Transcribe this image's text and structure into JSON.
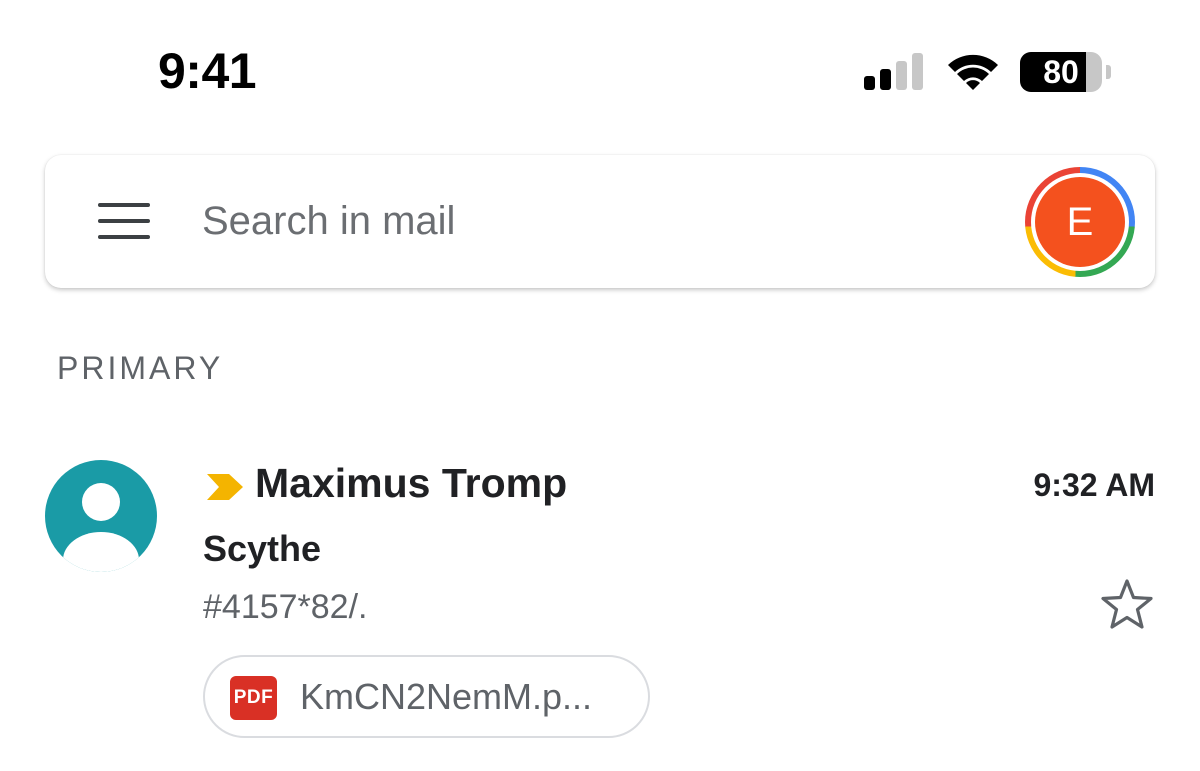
{
  "status_bar": {
    "time": "9:41",
    "battery_level": "80",
    "signal_bars_active": 2,
    "signal_bars_total": 4
  },
  "search": {
    "placeholder": "Search in mail",
    "account_initial": "E",
    "account_avatar_color": "#f4511e"
  },
  "section": {
    "label": "PRIMARY"
  },
  "emails": [
    {
      "sender": "Maximus Tromp",
      "time": "9:32 AM",
      "subject": "Scythe",
      "snippet": "#4157*82/.",
      "important": true,
      "starred": false,
      "avatar_color": "#1a9ba6",
      "attachment": {
        "type_label": "PDF",
        "name": "KmCN2NemM.p..."
      }
    }
  ],
  "colors": {
    "importance_marker": "#f4b400",
    "pdf_badge": "#d93025",
    "secondary_text": "#5f6368",
    "primary_text": "#202124"
  }
}
